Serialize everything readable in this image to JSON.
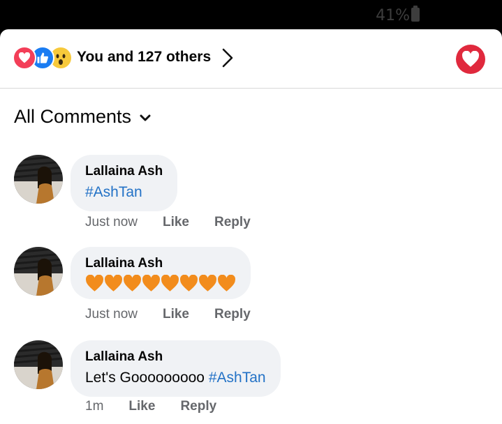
{
  "status_bar": {
    "battery": "41%"
  },
  "reactions": {
    "summary": "You and 127 others",
    "types": [
      "love",
      "like",
      "wow"
    ]
  },
  "comments_header": {
    "sort_label": "All Comments"
  },
  "comments": [
    {
      "author": "Lallaina Ash",
      "text_plain": "",
      "hashtag": "#AshTan",
      "time": "Just now",
      "like": "Like",
      "reply": "Reply"
    },
    {
      "author": "Lallaina Ash",
      "emoji": "🧡🧡🧡🧡🧡🧡🧡🧡",
      "time": "Just now",
      "like": "Like",
      "reply": "Reply"
    },
    {
      "author": "Lallaina Ash",
      "text_plain": "Let's Gooooooooo ",
      "hashtag": "#AshTan",
      "time": "1m",
      "like": "Like",
      "reply": "Reply"
    }
  ],
  "colors": {
    "hashtag": "#2372c6",
    "love": "#f33e58",
    "like": "#1a7cf2",
    "wow": "#f7c93b",
    "orange_heart": "#f28c1c"
  }
}
